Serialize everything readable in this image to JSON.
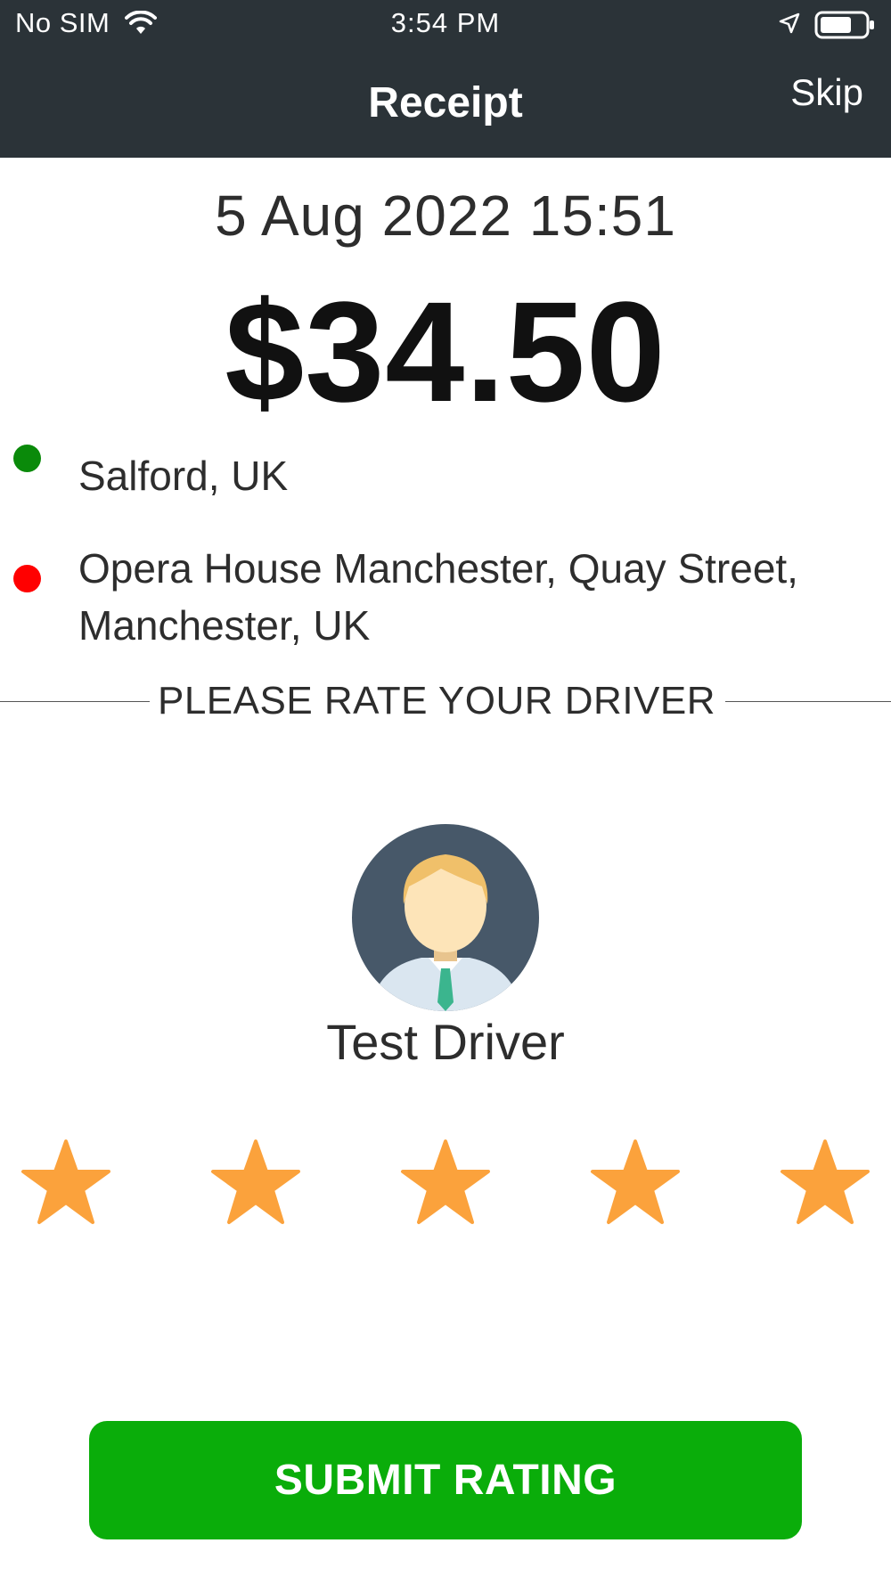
{
  "status_bar": {
    "carrier": "No SIM",
    "time": "3:54 PM"
  },
  "nav": {
    "title": "Receipt",
    "skip_label": "Skip"
  },
  "receipt": {
    "datetime": "5 Aug 2022 15:51",
    "amount": "$34.50",
    "pickup": "Salford, UK",
    "dropoff": "Opera House Manchester, Quay Street, Manchester, UK",
    "pickup_color": "#0a8a0a",
    "dropoff_color": "#ff0000"
  },
  "rating": {
    "prompt": "PLEASE RATE YOUR DRIVER",
    "driver_name": "Test Driver",
    "stars_total": 5,
    "stars_selected": 5,
    "star_color": "#fba23c",
    "submit_label": "SUBMIT RATING",
    "submit_color": "#0aad0a"
  },
  "icons": [
    "wifi-icon",
    "location-arrow-icon",
    "battery-icon",
    "driver-avatar",
    "star-icon"
  ]
}
